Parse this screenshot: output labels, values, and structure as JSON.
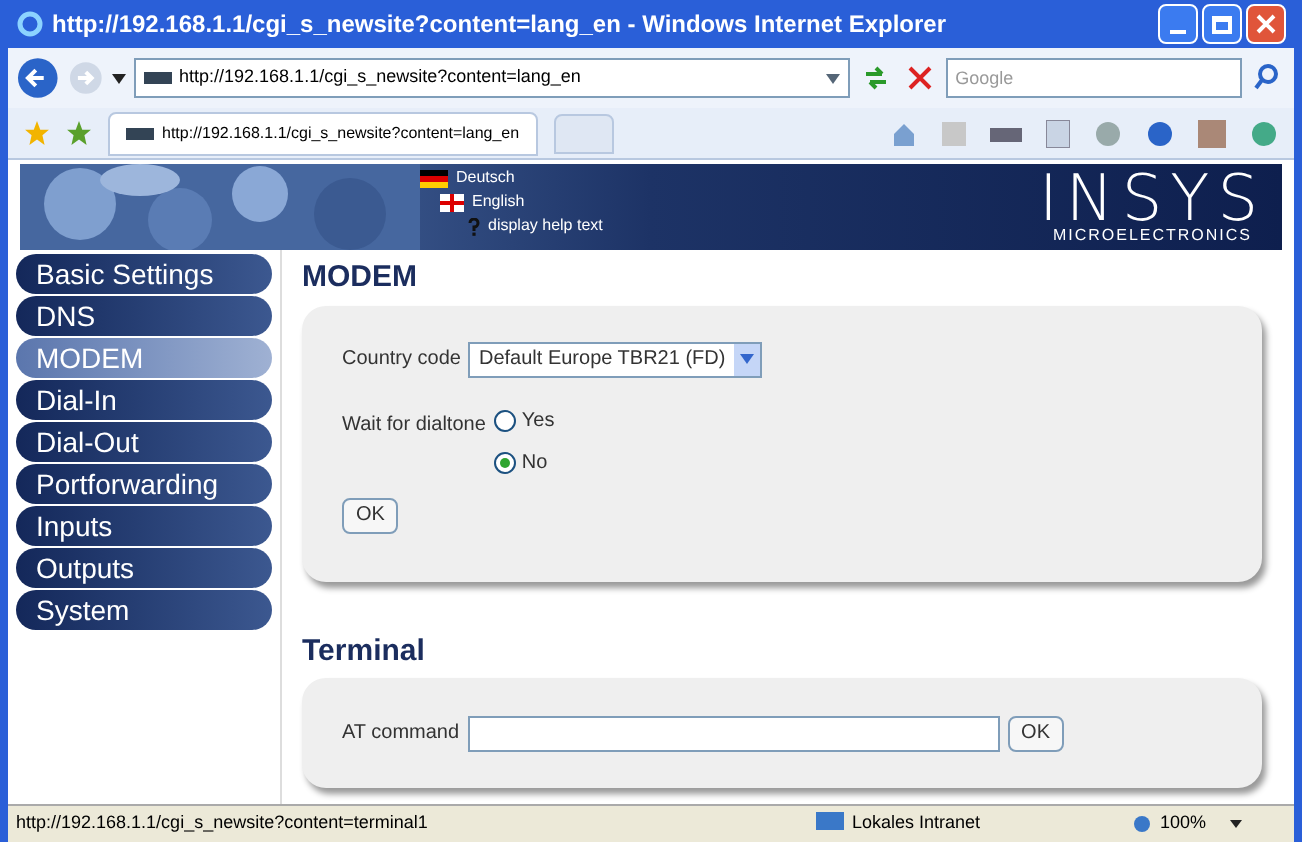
{
  "window": {
    "title": "http://192.168.1.1/cgi_s_newsite?content=lang_en - Windows Internet Explorer"
  },
  "address_bar": {
    "value": "http://192.168.1.1/cgi_s_newsite?content=lang_en"
  },
  "search": {
    "placeholder": "Google"
  },
  "tabs": [
    {
      "label": "http://192.168.1.1/cgi_s_newsite?content=lang_en",
      "selected": true
    }
  ],
  "header": {
    "links": [
      {
        "kind": "flag-de",
        "label": "Deutsch"
      },
      {
        "kind": "flag-uk",
        "label": "English"
      },
      {
        "kind": "help",
        "label": "display help text"
      }
    ],
    "logo": "INSYS",
    "logo_sub": "MICROELECTRONICS"
  },
  "sidebar": {
    "items": [
      {
        "label": "Basic Settings",
        "selected": false
      },
      {
        "label": "DNS",
        "selected": false
      },
      {
        "label": "MODEM",
        "selected": true
      },
      {
        "label": "Dial-In",
        "selected": false
      },
      {
        "label": "Dial-Out",
        "selected": false
      },
      {
        "label": "Portforwarding",
        "selected": false
      },
      {
        "label": "Inputs",
        "selected": false
      },
      {
        "label": "Outputs",
        "selected": false
      },
      {
        "label": "System",
        "selected": false
      }
    ]
  },
  "modem": {
    "title": "MODEM",
    "country_label": "Country code",
    "country_value": "Default Europe TBR21 (FD)",
    "dialtone_label": "Wait for dialtone",
    "options": [
      {
        "label": "Yes",
        "selected": false
      },
      {
        "label": "No",
        "selected": true
      }
    ],
    "button": "OK"
  },
  "terminal": {
    "title": "Terminal",
    "label": "AT command",
    "button": "OK"
  },
  "status_bar": {
    "url": "http://192.168.1.1/cgi_s_newsite?content=terminal1",
    "zone": "Lokales Intranet",
    "zoom": "100%"
  }
}
